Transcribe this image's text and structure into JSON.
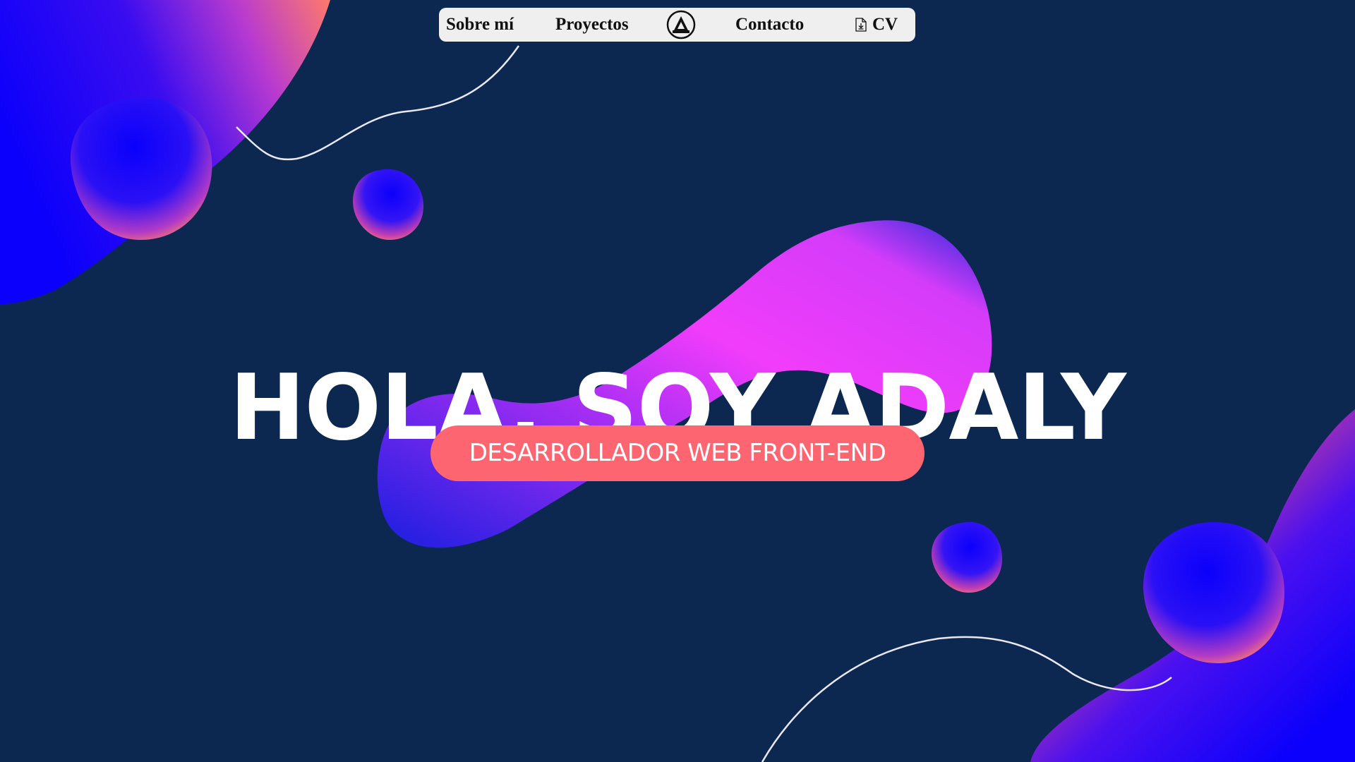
{
  "nav": {
    "about_label": "Sobre mí",
    "projects_label": "Proyectos",
    "logo_icon": "delta-logo-icon",
    "contact_label": "Contacto",
    "cv_label": "CV",
    "cv_icon": "document-download-icon"
  },
  "hero": {
    "title": "HOLA, SOY ADALY",
    "subtitle": "DESARROLLADOR WEB FRONT-END"
  },
  "colors": {
    "background": "#0c2851",
    "accent": "#fd6670",
    "magenta": "#f23cfb",
    "blue": "#0b00fb",
    "coral": "#fe7a6b",
    "nav_background": "#efefef",
    "text": "#ffffff"
  }
}
